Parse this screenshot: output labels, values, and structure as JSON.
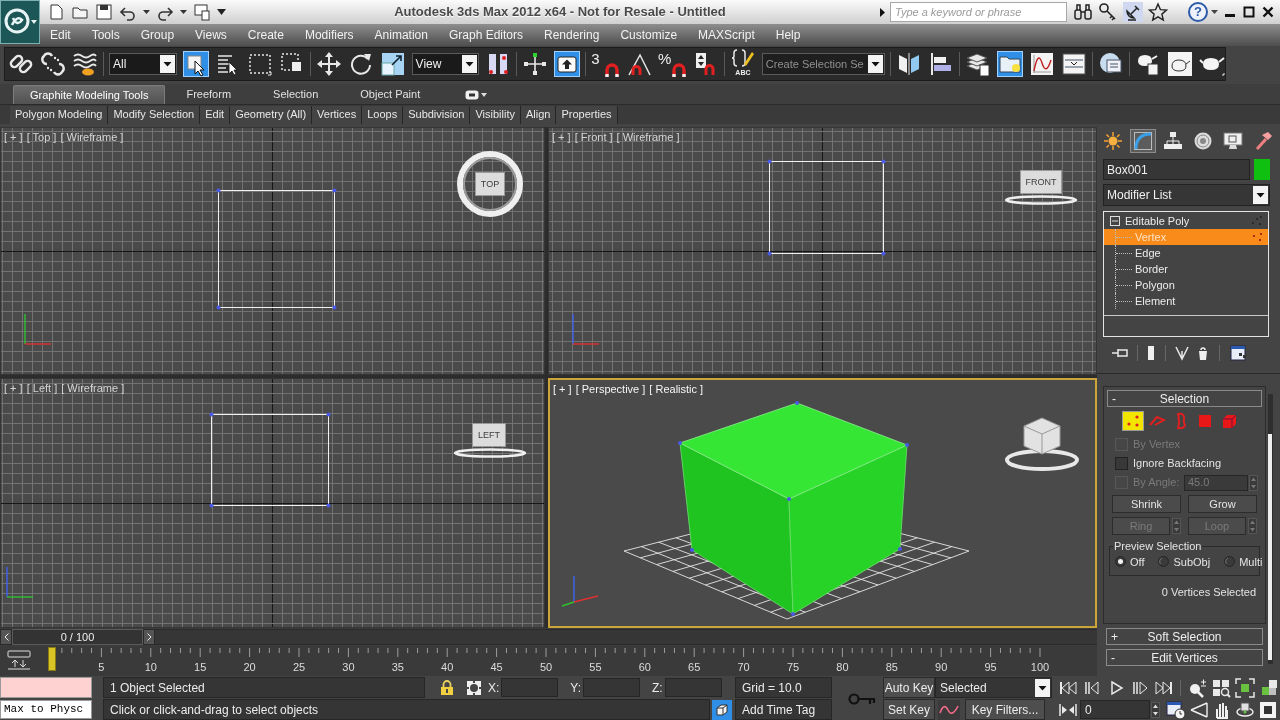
{
  "title_bar": {
    "title": "Autodesk 3ds Max 2012 x64 - Not for Resale - Untitled",
    "search": {
      "placeholder": "Type a keyword or phrase"
    },
    "help": "?"
  },
  "menu_bar": {
    "items": [
      "Edit",
      "Tools",
      "Group",
      "Views",
      "Create",
      "Modifiers",
      "Animation",
      "Graph Editors",
      "Rendering",
      "Customize",
      "MAXScript",
      "Help"
    ]
  },
  "main_toolbar": {
    "groups": [
      [
        {
          "kind": "button",
          "active": false
        },
        {
          "kind": "button",
          "active": false
        },
        {
          "kind": "button",
          "active": false
        }
      ],
      [
        {
          "kind": "dropdown",
          "value": "All"
        },
        {
          "kind": "button",
          "active": true
        },
        {
          "kind": "button",
          "active": false
        },
        {
          "kind": "button",
          "active": false
        },
        {
          "kind": "button",
          "active": false
        }
      ],
      [
        {
          "kind": "button",
          "active": false
        },
        {
          "kind": "button",
          "active": false
        },
        {
          "kind": "button",
          "active": false
        },
        {
          "kind": "dropdown",
          "value": "View"
        },
        {
          "kind": "button",
          "active": false
        }
      ],
      [
        {
          "kind": "button",
          "active": false
        },
        {
          "kind": "button",
          "active": true
        }
      ],
      [
        {
          "kind": "snap_button",
          "label": "3",
          "active": false
        },
        {
          "kind": "button",
          "active": false
        },
        {
          "kind": "snap_button",
          "label": "%",
          "active": false
        },
        {
          "kind": "button",
          "active": false
        }
      ],
      [
        {
          "kind": "caption_button",
          "label": "ABC",
          "active": false
        },
        {
          "kind": "combo",
          "placeholder": "Create Selection Se"
        }
      ],
      [
        {
          "kind": "button",
          "active": false
        },
        {
          "kind": "button",
          "active": false
        }
      ],
      [
        {
          "kind": "button",
          "active": false
        },
        {
          "kind": "button",
          "active": true
        },
        {
          "kind": "button",
          "active": false
        },
        {
          "kind": "button",
          "active": false
        }
      ],
      [
        {
          "kind": "button",
          "active": false
        }
      ],
      [
        {
          "kind": "button",
          "active": false
        },
        {
          "kind": "button",
          "active": false
        },
        {
          "kind": "button",
          "active": false
        }
      ]
    ]
  },
  "ribbon": {
    "tabs": [
      {
        "label": "Graphite Modeling Tools",
        "selected": true
      },
      {
        "label": "Freeform",
        "selected": false
      },
      {
        "label": "Selection",
        "selected": false
      },
      {
        "label": "Object Paint",
        "selected": false
      }
    ],
    "panels": [
      "Polygon Modeling",
      "Modify Selection",
      "Edit",
      "Geometry (All)",
      "Vertices",
      "Loops",
      "Subdivision",
      "Visibility",
      "Align",
      "Properties"
    ]
  },
  "viewports": [
    {
      "kind": "top",
      "labels": [
        "[ + ]",
        "[ Top ]",
        "[ Wireframe ]"
      ],
      "viewcube": "TOP",
      "active": false
    },
    {
      "kind": "front",
      "labels": [
        "[ + ]",
        "[ Front ]",
        "[ Wireframe ]"
      ],
      "viewcube": "FRONT",
      "active": false
    },
    {
      "kind": "left",
      "labels": [
        "[ + ]",
        "[ Left ]",
        "[ Wireframe ]"
      ],
      "viewcube": "LEFT",
      "active": false
    },
    {
      "kind": "perspective",
      "labels": [
        "[ + ]",
        "[ Perspective ]",
        "[ Realistic ]"
      ],
      "active": true
    }
  ],
  "time_slider": {
    "label": "0 / 100"
  },
  "track_bar": {
    "ticks": [
      "5",
      "10",
      "15",
      "20",
      "25",
      "30",
      "35",
      "40",
      "45",
      "50",
      "55",
      "60",
      "65",
      "70",
      "75",
      "80",
      "85",
      "90",
      "95",
      "100"
    ]
  },
  "command_panel": {
    "tabs": [
      {
        "selected": false
      },
      {
        "selected": true
      },
      {
        "selected": false
      },
      {
        "selected": false
      },
      {
        "selected": false
      },
      {
        "selected": false
      }
    ],
    "object_name": "Box001",
    "modifier_list": "Modifier List",
    "stack": [
      {
        "label": "Editable Poly",
        "expanded": true,
        "selected": false,
        "children": [
          {
            "label": "Vertex",
            "selected": true
          },
          {
            "label": "Edge",
            "selected": false
          },
          {
            "label": "Border",
            "selected": false
          },
          {
            "label": "Polygon",
            "selected": false
          },
          {
            "label": "Element",
            "selected": false
          }
        ]
      }
    ],
    "rollouts": [
      {
        "kind": "selection",
        "sign": "-",
        "title": "Selection",
        "levels": [
          {
            "selected": true
          },
          {
            "selected": false
          },
          {
            "selected": false
          },
          {
            "selected": false
          },
          {
            "selected": false
          }
        ],
        "options": [
          {
            "label": "By Vertex",
            "checked": false,
            "disabled": true
          },
          {
            "label": "Ignore Backfacing",
            "checked": false,
            "disabled": false
          },
          {
            "label": "By Angle:",
            "checked": false,
            "disabled": true,
            "value": "45.0"
          }
        ],
        "buttons": [
          {
            "kind": "button",
            "label": "Shrink",
            "disabled": false
          },
          {
            "kind": "button",
            "label": "Grow",
            "disabled": false
          },
          {
            "kind": "spinner_button",
            "label": "Ring",
            "disabled": true
          },
          {
            "kind": "spinner_button",
            "label": "Loop",
            "disabled": true
          }
        ],
        "preview": {
          "title": "Preview Selection",
          "options": [
            {
              "label": "Off",
              "selected": true
            },
            {
              "label": "SubObj",
              "selected": false
            },
            {
              "label": "Multi",
              "selected": false
            }
          ]
        },
        "status": "0 Vertices Selected"
      },
      {
        "kind": "header",
        "sign": "+",
        "title": "Soft Selection"
      },
      {
        "kind": "header",
        "sign": "-",
        "title": "Edit Vertices"
      }
    ]
  },
  "status_bar": {
    "listener_output": "Max to Physc",
    "selection_info": "1 Object Selected",
    "prompt": "Click or click-and-drag to select objects",
    "coordinates": [
      "X:",
      "Y:",
      "Z:"
    ],
    "grid": "Grid = 10.0",
    "time_tag": "Add Time Tag",
    "adaptive_degradation": {
      "active": true
    },
    "auto_key": "Auto Key",
    "key_mode": "Selected",
    "set_key": "Set Key",
    "key_filters": "Key Filters...",
    "frame": "0"
  }
}
